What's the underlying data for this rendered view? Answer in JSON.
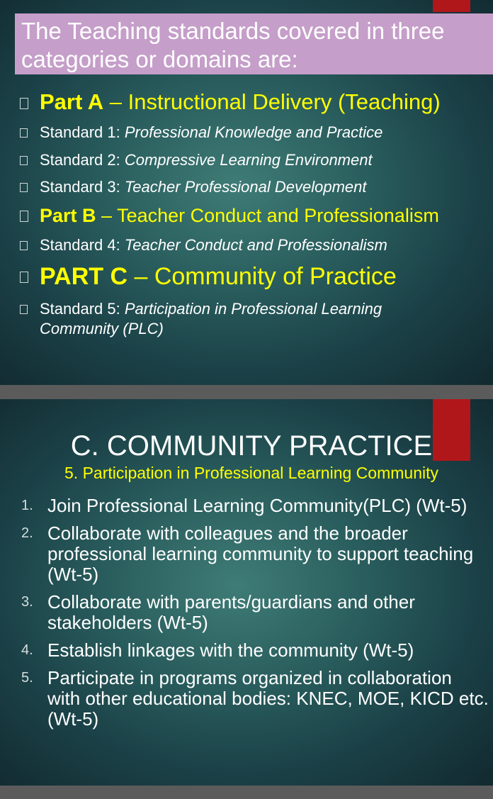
{
  "slide1": {
    "heading": "The Teaching standards covered in three categories or domains are:",
    "rows": [
      {
        "type": "part",
        "bold": "Part A",
        "rest": " – Instructional Delivery (Teaching)"
      },
      {
        "type": "std",
        "label": "Standard 1:  ",
        "title": "Professional Knowledge and Practice"
      },
      {
        "type": "std",
        "label": "Standard 2:",
        "title": " Compressive Learning Environment"
      },
      {
        "type": "std",
        "label": "Standard 3:  ",
        "title": "Teacher Professional Development"
      },
      {
        "type": "part",
        "bold": "Part B",
        "rest": " – Teacher Conduct and Professionalism"
      },
      {
        "type": "std",
        "label": "Standard 4:  ",
        "title": "Teacher Conduct and Professionalism"
      },
      {
        "type": "part",
        "bold": "PART C",
        "rest": " – Community of Practice"
      },
      {
        "type": "std",
        "label": "Standard 5:   ",
        "title": "Participation in Professional Learning",
        "title_line2": "Community (PLC)"
      }
    ]
  },
  "slide2": {
    "title": "C. COMMUNITY PRACTICE",
    "subtitle": "5. Participation in Professional Learning Community",
    "items": [
      {
        "num": "1.",
        "text": "Join Professional Learning Community(PLC) (Wt-5)"
      },
      {
        "num": "2.",
        "text": "Collaborate with colleagues and the broader professional learning community to support teaching (Wt-5)"
      },
      {
        "num": "3.",
        "text": "Collaborate with parents/guardians and other stakeholders (Wt-5)"
      },
      {
        "num": "4.",
        "text": "Establish linkages with the community (Wt-5)"
      },
      {
        "num": "5.",
        "text": "Participate in programs organized in collaboration with other educational bodies: KNEC, MOE, KICD etc. (Wt-5)"
      }
    ]
  }
}
